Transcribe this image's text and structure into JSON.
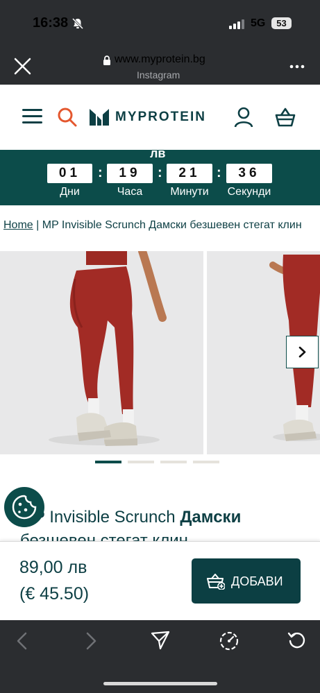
{
  "status_bar": {
    "time": "16:38",
    "network": "5G",
    "battery": "53",
    "icons": [
      "bell-off-icon",
      "signal-icon"
    ]
  },
  "browser": {
    "url": "www.myprotein.bg",
    "source": "Instagram",
    "icons": [
      "close-icon",
      "lock-icon",
      "more-icon"
    ]
  },
  "header": {
    "logo_text": "MYPROTEIN",
    "icons": [
      "menu-icon",
      "search-icon",
      "account-icon",
      "basket-icon"
    ],
    "search_icon_color": "#e4572e",
    "brand_color": "#0d3f44"
  },
  "countdown": {
    "currency": "лв",
    "units": [
      {
        "value": "01",
        "label": "Дни"
      },
      {
        "value": "19",
        "label": "Часа"
      },
      {
        "value": "21",
        "label": "Минути"
      },
      {
        "value": "36",
        "label": "Секунди"
      }
    ],
    "background": "#0c4c4a"
  },
  "breadcrumb": {
    "home": "Home",
    "separator": "|",
    "current": "MP Invisible Scrunch Дамски безшевен стегат клин"
  },
  "gallery": {
    "active_index": 0,
    "dot_count": 4,
    "next_icon": "chevron-right-icon"
  },
  "product": {
    "title_regular": "MP Invisible Scrunch ",
    "title_bold": "Дамски",
    "title_line2": "безшевен стегат клин"
  },
  "purchase": {
    "price": "89,00 лв",
    "price_eur": "(€ 45.50)",
    "add_label": "ДОБАВИ",
    "add_icon": "basket-plus-icon"
  },
  "bottom_toolbar": {
    "icons": [
      "back-icon",
      "forward-icon",
      "share-icon",
      "speed-icon",
      "reload-icon"
    ]
  },
  "cookie": {
    "icon": "cookie-icon"
  }
}
